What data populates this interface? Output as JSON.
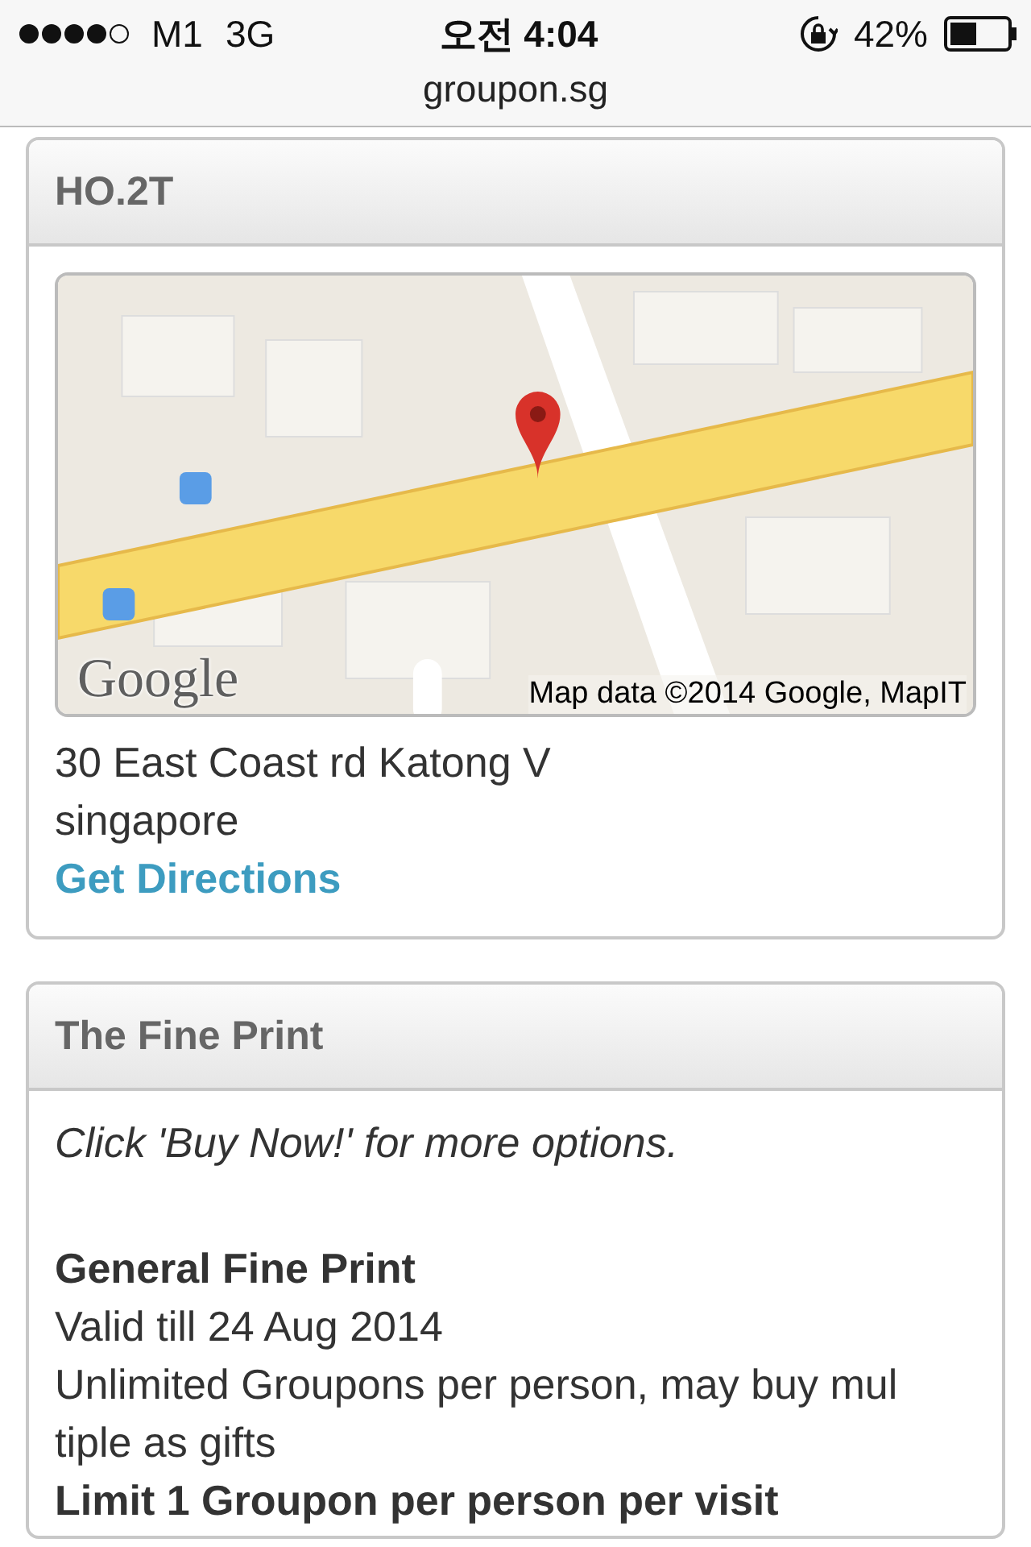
{
  "status_bar": {
    "carrier": "M1",
    "network": "3G",
    "time": "오전 4:04",
    "battery": "42%"
  },
  "url_bar": {
    "domain": "groupon.sg"
  },
  "location_card": {
    "title": "HO.2T",
    "map": {
      "kind": "picture",
      "logo": "Google",
      "attribution": "Map data ©2014 Google, MapIT"
    },
    "address_lines": [
      "30 East Coast rd Katong V",
      "singapore"
    ],
    "link": "Get Directions"
  },
  "fine_print_card": {
    "title": "The Fine Print",
    "note": "Click 'Buy Now!' for more options.",
    "heading": "General Fine Print",
    "lines": [
      {
        "kind": "plain",
        "text": "Valid till 24 Aug 2014"
      },
      {
        "kind": "plain",
        "text": "Unlimited Groupons per person, may buy mul"
      },
      {
        "kind": "plain",
        "text": "tiple as gifts"
      },
      {
        "kind": "bold",
        "text": "Limit 1 Groupon per person per visit"
      }
    ]
  }
}
